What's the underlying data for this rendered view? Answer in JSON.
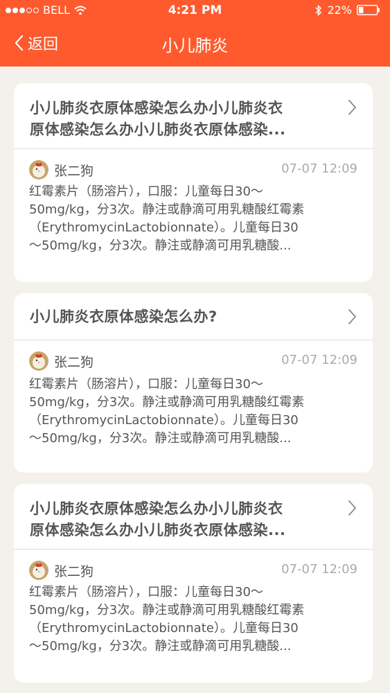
{
  "status_bar": {
    "carrier": "BELL",
    "time": "4:21 PM",
    "battery": "22%"
  },
  "nav": {
    "back_label": "返回",
    "title": "小儿肺炎"
  },
  "posts": [
    {
      "title": "小儿肺炎衣原体感染怎么办小儿肺炎衣\n原体感染怎么办小儿肺炎衣原体感染...",
      "author": "张二狗",
      "time": "07-07 12:09",
      "body": "红霉素片（肠溶片），口服：儿童每日30～\n50mg/kg，分3次。静注或静滴可用乳糖酸红霉素\n（ErythromycinLactobionnate）。儿童每日30\n～50mg/kg，分3次。静注或静滴可用乳糖酸..."
    },
    {
      "title": "小儿肺炎衣原体感染怎么办?",
      "author": "张二狗",
      "time": "07-07 12:09",
      "body": "红霉素片（肠溶片），口服：儿童每日30～\n50mg/kg，分3次。静注或静滴可用乳糖酸红霉素\n（ErythromycinLactobionnate）。儿童每日30\n～50mg/kg，分3次。静注或静滴可用乳糖酸..."
    },
    {
      "title": "小儿肺炎衣原体感染怎么办小儿肺炎衣\n原体感染怎么办小儿肺炎衣原体感染...",
      "author": "张二狗",
      "time": "07-07 12:09",
      "body": "红霉素片（肠溶片），口服：儿童每日30～\n50mg/kg，分3次。静注或静滴可用乳糖酸红霉素\n（ErythromycinLactobionnate）。儿童每日30\n～50mg/kg，分3次。静注或静滴可用乳糖酸..."
    }
  ],
  "colors": {
    "header": "#ff5a2e",
    "background": "#f4f1ec",
    "card": "#ffffff",
    "text": "#555555",
    "time": "#aaaaaa"
  },
  "icons": {
    "back": "chevron-left-icon",
    "post_arrow": "chevron-right-icon",
    "avatar": "rooster-avatar"
  }
}
